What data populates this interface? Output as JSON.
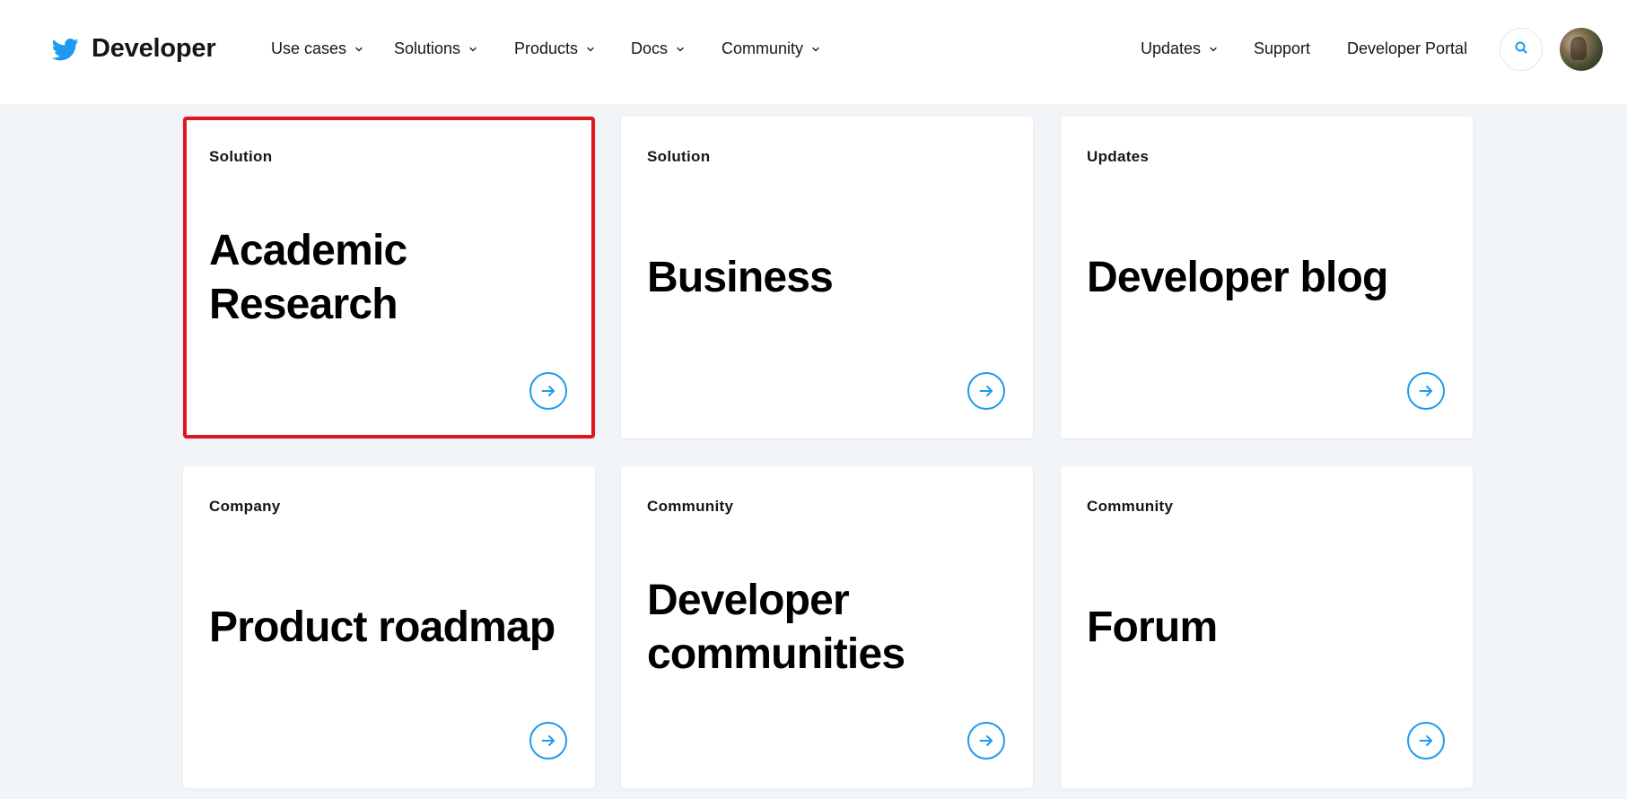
{
  "header": {
    "brand": "Developer",
    "nav_left": [
      {
        "label": "Use cases",
        "has_dropdown": true
      },
      {
        "label": "Solutions",
        "has_dropdown": true
      },
      {
        "label": "Products",
        "has_dropdown": true
      },
      {
        "label": "Docs",
        "has_dropdown": true
      },
      {
        "label": "Community",
        "has_dropdown": true
      }
    ],
    "nav_right": [
      {
        "label": "Updates",
        "has_dropdown": true
      },
      {
        "label": "Support",
        "has_dropdown": false
      },
      {
        "label": "Developer Portal",
        "has_dropdown": false
      }
    ],
    "search_icon": "search-icon",
    "avatar": "user-avatar"
  },
  "colors": {
    "accent": "#1d9bf0",
    "highlight_border": "#e0161f",
    "page_bg": "#f1f5f8"
  },
  "cards": [
    {
      "kicker": "Solution",
      "title": "Academic Research",
      "highlighted": true
    },
    {
      "kicker": "Solution",
      "title": "Business",
      "highlighted": false
    },
    {
      "kicker": "Updates",
      "title": "Developer blog",
      "highlighted": false
    },
    {
      "kicker": "Company",
      "title": "Product roadmap",
      "highlighted": false
    },
    {
      "kicker": "Community",
      "title": "Developer communities",
      "highlighted": false
    },
    {
      "kicker": "Community",
      "title": "Forum",
      "highlighted": false
    }
  ]
}
